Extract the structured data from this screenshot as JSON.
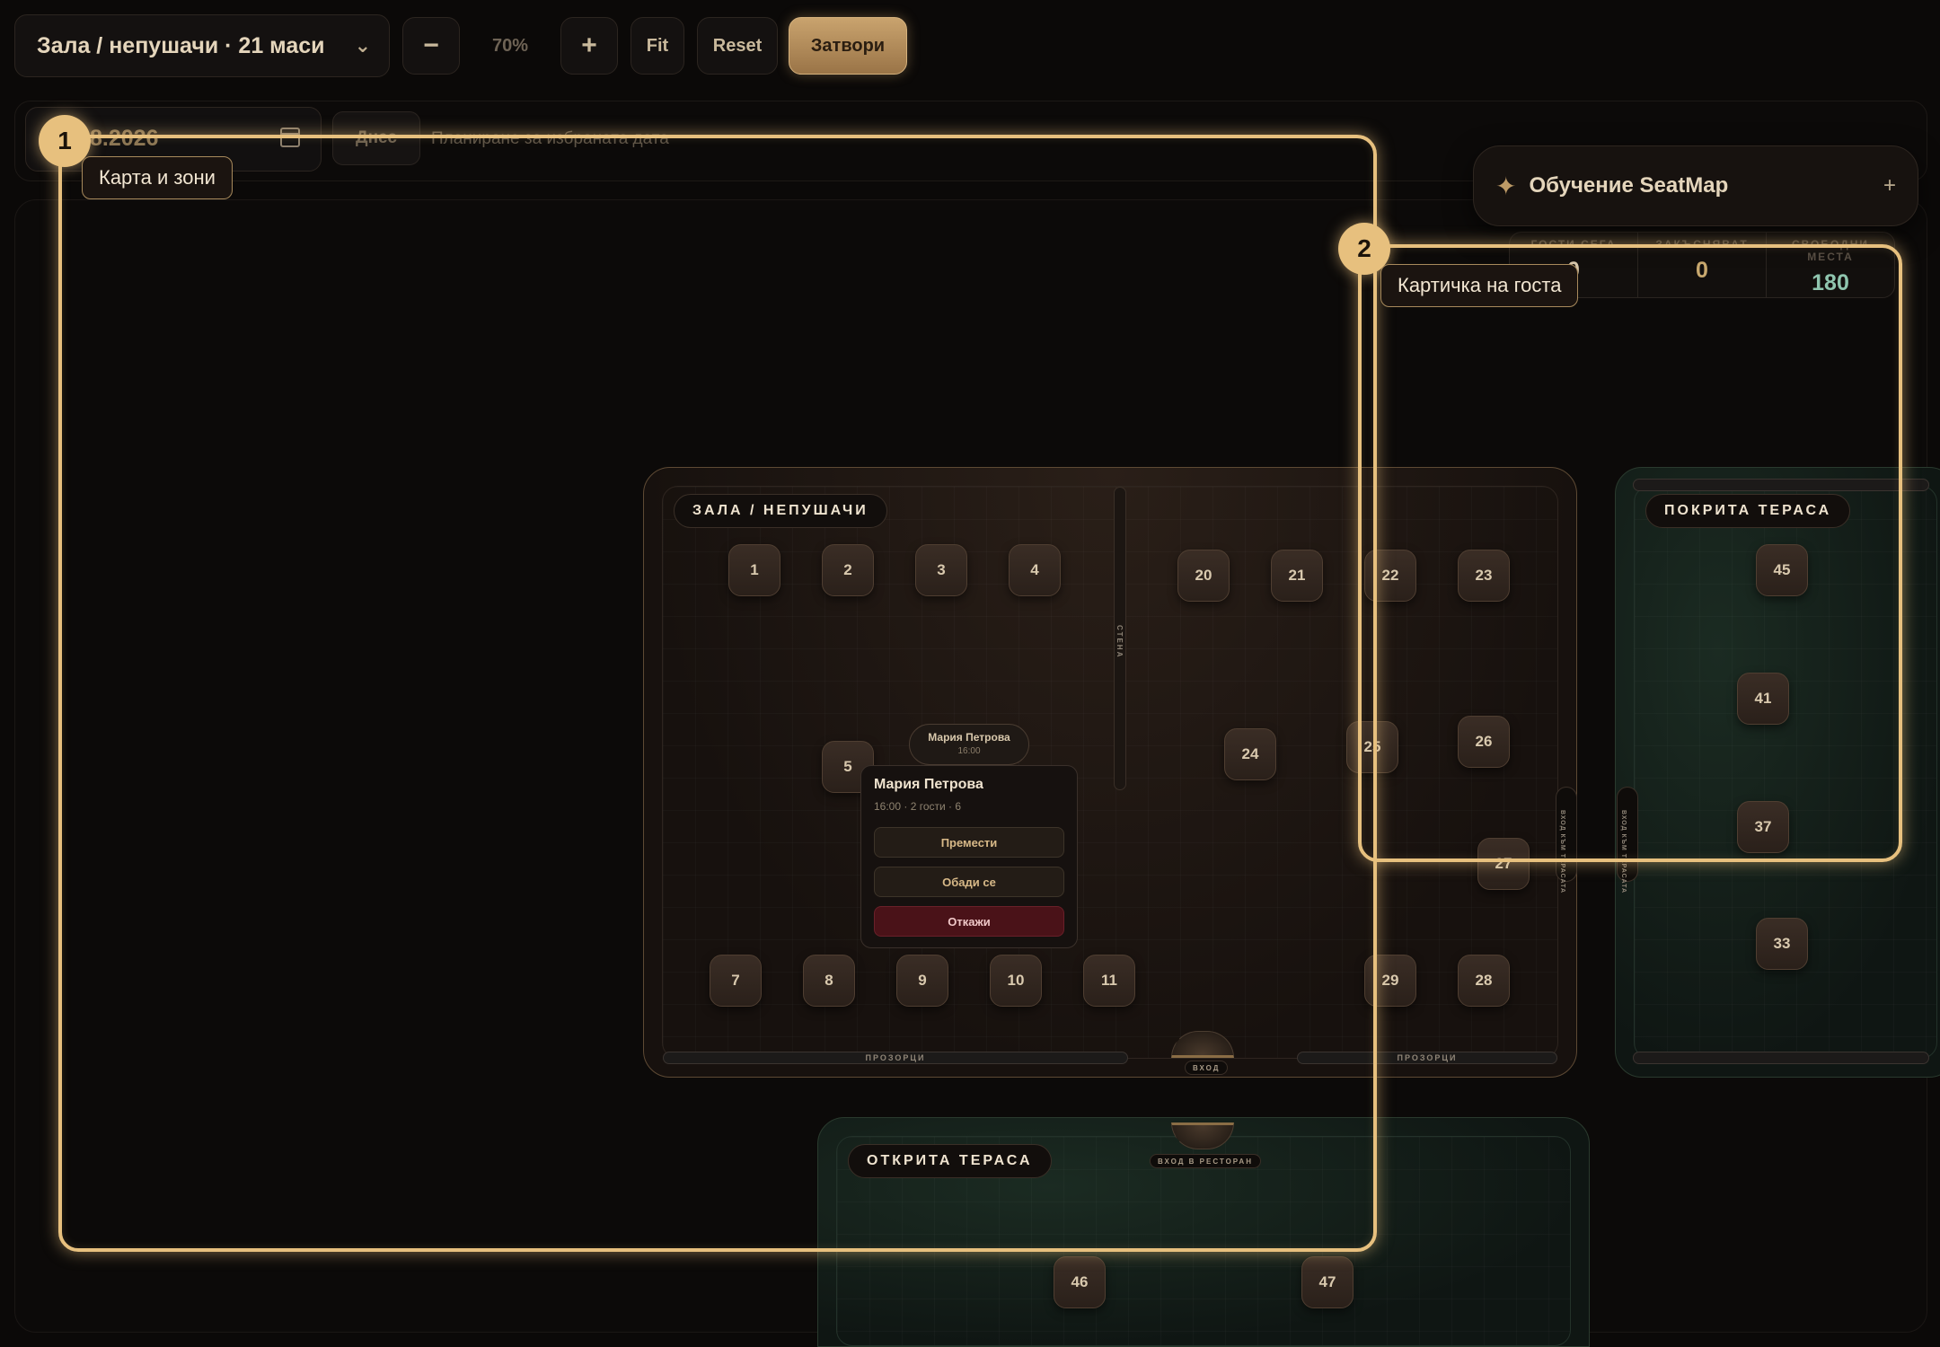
{
  "toolbar": {
    "zone_select": "Зала / непушачи · 21 маси",
    "zoom_out": "−",
    "zoom_level": "70%",
    "zoom_in": "+",
    "fit": "Fit",
    "reset": "Reset",
    "close": "Затвори"
  },
  "date_bar": {
    "date_value": "8.2026",
    "today": "Днес",
    "hint": "Планиране за избраната дата"
  },
  "stats": {
    "guests_label": "ГОСТИ СЕГА",
    "guests_value": "0",
    "booked_label": "ЗАКЪСНЯВАТ",
    "booked_value": "0",
    "free_label": "СВОБОДНИ МЕСТА",
    "free_value": "180",
    "colors": {
      "booked": "#c8a86e",
      "free": "#8fc5ae"
    }
  },
  "coach": {
    "title": "Обучение SeatMap",
    "plus": "+"
  },
  "zones": {
    "hall": {
      "title": "ЗАЛА / НЕПУШАЧИ",
      "tables": [
        "1",
        "2",
        "3",
        "4",
        "20",
        "21",
        "22",
        "23",
        "5",
        "24",
        "25",
        "26",
        "27",
        "7",
        "8",
        "9",
        "10",
        "11",
        "29",
        "28"
      ],
      "wall_label": "СТЕНА",
      "windows_left": "ПРОЗОРЦИ",
      "windows_right": "ПРОЗОРЦИ",
      "entry": "ВХОД",
      "terrace_door": "ВХОД КЪМ ТЕРАСАТА"
    },
    "covered_terrace": {
      "title": "ПОКРИТА ТЕРАСА",
      "tables": [
        "45",
        "41",
        "37",
        "33"
      ],
      "terrace_door": "ВХОД КЪМ ТЕРАСАТА"
    },
    "open_terrace": {
      "title": "ОТКРИТА ТЕРАСА",
      "entry": "ВХОД В РЕСТОРАН",
      "tables": [
        "46",
        "47"
      ]
    }
  },
  "reservation": {
    "pill_name": "Мария Петрова",
    "pill_time": "16:00",
    "name": "Мария Петрова",
    "details": "16:00 · 2 гости · 6",
    "move": "Премести",
    "call": "Обади се",
    "cancel": "Откажи"
  },
  "tour": {
    "step1_number": "1",
    "step1_label": "Карта и зони",
    "step2_number": "2",
    "step2_label": "Картичка на госта",
    "accent": "#e7c07e"
  }
}
